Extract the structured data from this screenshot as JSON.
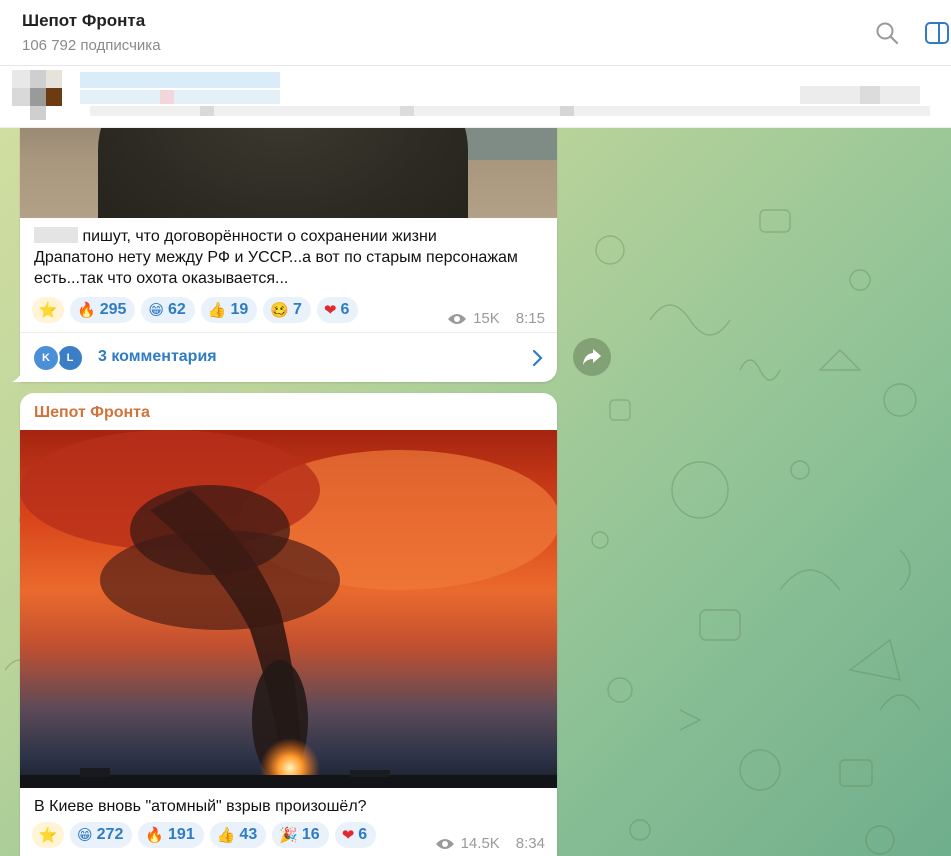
{
  "header": {
    "title": "Шепот Фронта",
    "subscribers": "106 792 подписчика",
    "icons": [
      "search-icon",
      "side-panel-icon"
    ]
  },
  "messages": [
    {
      "text_line1": "пишут, что договорённости о сохранении жизни",
      "text_line2": "Драпатоно нету между РФ и УССР...а вот по старым персонажам",
      "text_line3": "есть...так что охота оказывается...",
      "reactions": [
        {
          "emoji": "⭐",
          "count": ""
        },
        {
          "emoji": "🔥",
          "count": "295"
        },
        {
          "emoji": "😁",
          "count": "62"
        },
        {
          "emoji": "👍",
          "count": "19"
        },
        {
          "emoji": "🥴",
          "count": "7"
        },
        {
          "emoji": "❤",
          "count": "6"
        }
      ],
      "views": "15K",
      "time": "8:15",
      "comments": {
        "avatars": [
          "K",
          "L"
        ],
        "label": "3 комментария"
      }
    },
    {
      "author": "Шепот Фронта",
      "text": "В Киеве вновь \"атомный\" взрыв произошёл?",
      "reactions": [
        {
          "emoji": "⭐",
          "count": ""
        },
        {
          "emoji": "😁",
          "count": "272"
        },
        {
          "emoji": "🔥",
          "count": "191"
        },
        {
          "emoji": "👍",
          "count": "43"
        },
        {
          "emoji": "🎉",
          "count": "16"
        },
        {
          "emoji": "❤",
          "count": "6"
        }
      ],
      "views": "14.5K",
      "time": "8:34"
    }
  ],
  "colors": {
    "accent": "#2f7cc4",
    "author": "#d2733b",
    "meta": "#9a9a9a"
  }
}
